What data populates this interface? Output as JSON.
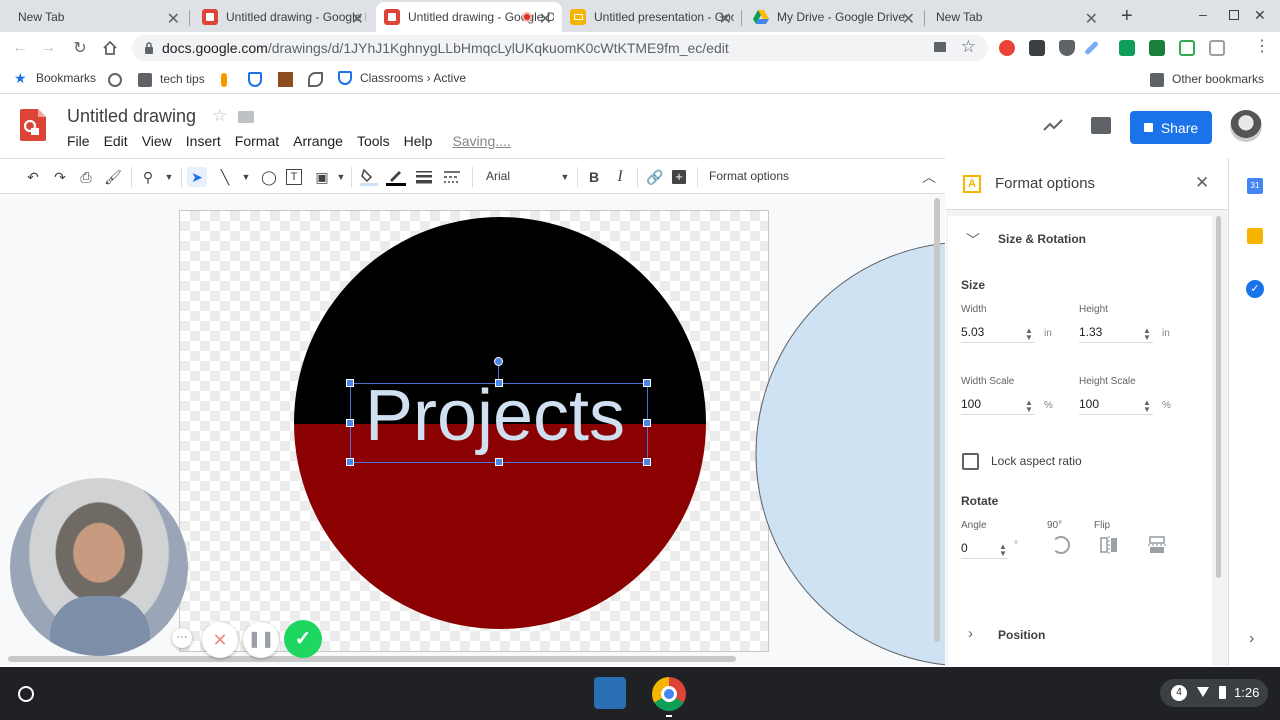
{
  "tabs": [
    {
      "title": "New Tab",
      "active": false
    },
    {
      "title": "Untitled drawing - Google Drawings",
      "active": false
    },
    {
      "title": "Untitled drawing - Google Drawings",
      "active": true
    },
    {
      "title": "Untitled presentation - Google Slides",
      "active": false
    },
    {
      "title": "My Drive - Google Drive",
      "active": false
    },
    {
      "title": "New Tab",
      "active": false
    }
  ],
  "address": {
    "host": "docs.google.com",
    "path": "/drawings/d/1JYhJ1KghnygLLbHmqcLylUKqkuomK0cWtKTME9fm_ec/edit"
  },
  "bookmarks": {
    "items": [
      "Bookmarks",
      "tech tips",
      "Classrooms › Active"
    ],
    "other": "Other bookmarks"
  },
  "doc": {
    "title": "Untitled drawing",
    "menus": [
      "File",
      "Edit",
      "View",
      "Insert",
      "Format",
      "Arrange",
      "Tools",
      "Help"
    ],
    "status": "Saving....",
    "share_label": "Share"
  },
  "toolbar": {
    "font": "Arial",
    "format_options": "Format options"
  },
  "canvas": {
    "text": "Projects"
  },
  "format_panel": {
    "title": "Format options",
    "section": "Size & Rotation",
    "size_label": "Size",
    "width_label": "Width",
    "width_value": "5.03",
    "height_label": "Height",
    "height_value": "1.33",
    "unit_in": "in",
    "width_scale_label": "Width Scale",
    "width_scale_value": "100",
    "height_scale_label": "Height Scale",
    "height_scale_value": "100",
    "unit_pct": "%",
    "lock_label": "Lock aspect ratio",
    "rotate_label": "Rotate",
    "angle_label": "Angle",
    "angle_value": "0",
    "angle_unit": "°",
    "rot90_label": "90°",
    "flip_label": "Flip",
    "position_label": "Position"
  },
  "shelf": {
    "time": "1:26",
    "notification_count": "4"
  },
  "colors": {
    "accent": "#1a73e8",
    "circle_top": "#000000",
    "circle_bottom": "#8b0000",
    "light_circle": "#cfe2f3",
    "recording_ok": "#1ed760"
  }
}
